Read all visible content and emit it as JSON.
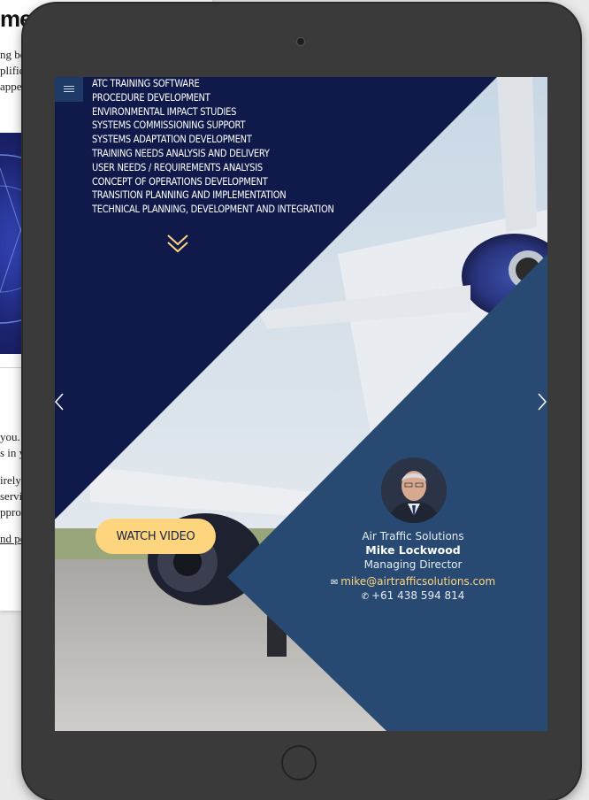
{
  "background_document": {
    "heading": "me",
    "lines_top": [
      "ng be",
      "plific",
      "appe"
    ],
    "lines_bottom": [
      "you. S",
      "s in yo",
      "",
      "irely r",
      "servic",
      "pproa",
      ""
    ],
    "link_text": "nd pe"
  },
  "menu": {
    "icon": "hamburger-icon"
  },
  "services": [
    "ATC TRAINING SOFTWARE",
    "PROCEDURE DEVELOPMENT",
    "ENVIRONMENTAL IMPACT STUDIES",
    "SYSTEMS COMMISSIONING SUPPORT",
    "SYSTEMS ADAPTATION DEVELOPMENT",
    "TRAINING NEEDS ANALYSIS AND DELIVERY",
    "USER NEEDS / REQUIREMENTS ANALYSIS",
    "CONCEPT OF OPERATIONS DEVELOPMENT",
    "TRANSITION PLANNING AND IMPLEMENTATION",
    "TECHNICAL PLANNING, DEVELOPMENT AND INTEGRATION"
  ],
  "cta": {
    "watch_video": "WATCH VIDEO"
  },
  "contact": {
    "company": "Air Traffic Solutions",
    "name": "Mike Lockwood",
    "role": "Managing Director",
    "email_glyph": "✉",
    "email": "mike@airtrafficsolutions.com",
    "phone_glyph": "✆",
    "phone": "+61 438 594 814"
  },
  "colors": {
    "navy": "#101a4a",
    "slate_blue": "#284a72",
    "accent_yellow": "#fdd57e",
    "tablet_frame": "#3a3a3a"
  }
}
